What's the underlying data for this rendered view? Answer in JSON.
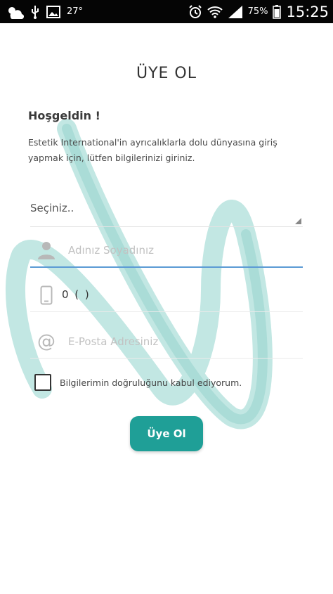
{
  "status_bar": {
    "temperature": "27°",
    "battery_percent": "75%",
    "time": "15:25",
    "icons": [
      "partly-cloudy-icon",
      "usb-icon",
      "image-icon",
      "alarm-icon",
      "wifi-icon",
      "signal-icon",
      "battery-icon"
    ]
  },
  "page": {
    "title": "ÜYE OL",
    "welcome": "Hoşgeldin !",
    "intro": "Estetik International'in ayrıcalıklarla dolu dünyasına giriş yapmak için, lütfen bilgilerinizi giriniz."
  },
  "form": {
    "select": {
      "value": "Seçiniz.."
    },
    "name": {
      "placeholder": "Adınız Soyadınız",
      "value": ""
    },
    "phone": {
      "value": "0 (  )"
    },
    "email": {
      "placeholder": "E-Posta Adresiniz",
      "value": ""
    },
    "agreement": {
      "label": "Bilgilerimin doğruluğunu kabul ediyorum.",
      "checked": false
    },
    "submit_label": "Üye Ol"
  },
  "colors": {
    "accent": "#1f9f97",
    "swirl": "#8fd3cc",
    "focus_underline": "#5b9bd5",
    "status_bar": "#050505"
  }
}
